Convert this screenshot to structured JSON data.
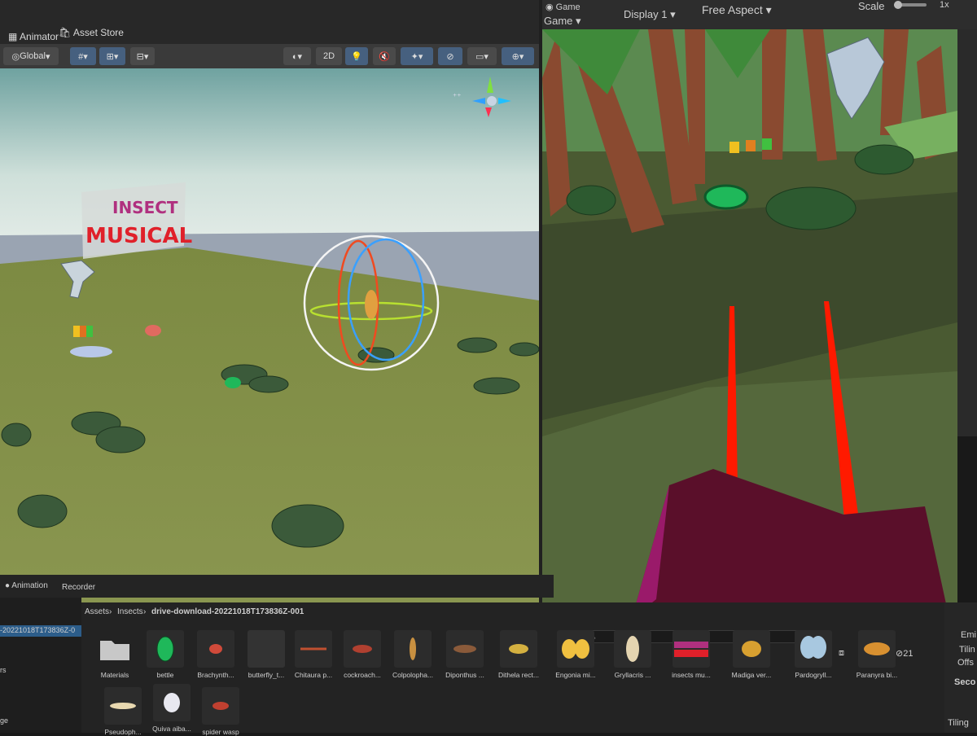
{
  "tabs": {
    "animator": "Animator",
    "asset_store": "Asset Store",
    "game": "Game",
    "game_header": "Game"
  },
  "scene_toolbar": {
    "pivot_mode": "Global",
    "mode_2d": "2D"
  },
  "game_toolbar": {
    "display": "Display 1",
    "aspect": "Free Aspect",
    "scale_label": "Scale",
    "scale_value": "1x"
  },
  "scene_objects": {
    "sign_line1": "INSECT",
    "sign_line2": "MUSICAL"
  },
  "bottom_tabs": {
    "animation": "Animation",
    "recorder": "Recorder"
  },
  "left_tree": {
    "item1": "-20221018T173836Z-0",
    "item2": "rs",
    "item3": "ge"
  },
  "project": {
    "breadcrumb": [
      "Assets",
      "Insects",
      "drive-download-20221018T173836Z-001"
    ],
    "visibility_count": "21",
    "assets_row1": [
      "Materials",
      "bettle",
      "Brachynth...",
      "butterfly_t...",
      "Chitaura p...",
      "cockroach...",
      "Colpolopha...",
      "Diponthus ...",
      "Dithela rect...",
      "Engonia mi...",
      "Gryllacris ...",
      "insects mu...",
      "Madiga ver...",
      "Pardogryll...",
      "Paranyra bi..."
    ],
    "assets_row2": [
      "Pseudoph...",
      "Quiva aiba...",
      "spider wasp"
    ]
  },
  "inspector": {
    "emi": "Emi",
    "tili": "Tilin",
    "offs": "Offs",
    "seco": "Seco",
    "tiling": "Tiling"
  },
  "colors": {
    "accent": "#3d79c9",
    "red_ray": "#ff1a00",
    "hand_box": "#5a0f2a",
    "sign_pink": "#b0307f",
    "sign_red": "#e0202a"
  }
}
